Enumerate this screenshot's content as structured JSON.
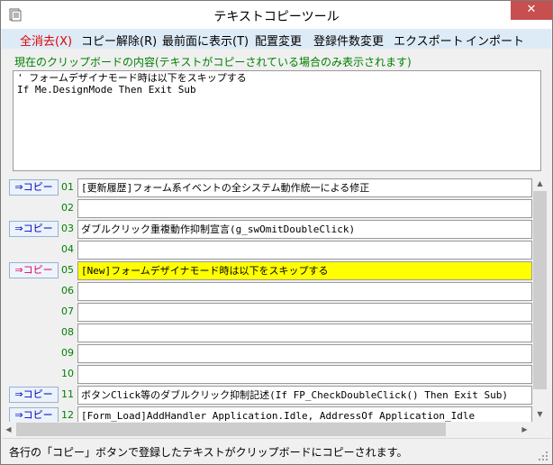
{
  "window": {
    "title": "テキストコピーツール",
    "close_label": "✕"
  },
  "menu": [
    "全消去(X)",
    "コピー解除(R)",
    "最前面に表示(T)",
    "配置変更",
    "登録件数変更",
    "エクスポート",
    "インポート"
  ],
  "clipboard": {
    "label": "現在のクリップボードの内容(テキストがコピーされている場合のみ表示されます)",
    "content": "' フォームデザイナモード時は以下をスキップする\nIf Me.DesignMode Then Exit Sub"
  },
  "copy_label": "⇒コピー",
  "rows": [
    {
      "num": "01",
      "text": "[更新履歴]フォーム系イベントの全システム動作統一による修正",
      "has_copy": true,
      "active": false
    },
    {
      "num": "02",
      "text": "",
      "has_copy": false,
      "active": false
    },
    {
      "num": "03",
      "text": "ダブルクリック重複動作抑制宣言(g_swOmitDoubleClick)",
      "has_copy": true,
      "active": false
    },
    {
      "num": "04",
      "text": "",
      "has_copy": false,
      "active": false
    },
    {
      "num": "05",
      "text": "[New]フォームデザイナモード時は以下をスキップする",
      "has_copy": true,
      "active": true
    },
    {
      "num": "06",
      "text": "",
      "has_copy": false,
      "active": false
    },
    {
      "num": "07",
      "text": "",
      "has_copy": false,
      "active": false
    },
    {
      "num": "08",
      "text": "",
      "has_copy": false,
      "active": false
    },
    {
      "num": "09",
      "text": "",
      "has_copy": false,
      "active": false
    },
    {
      "num": "10",
      "text": "",
      "has_copy": false,
      "active": false
    },
    {
      "num": "11",
      "text": "ボタンClick等のダブルクリック抑制記述(If FP_CheckDoubleClick() Then Exit Sub)",
      "has_copy": true,
      "active": false
    },
    {
      "num": "12",
      "text": "[Form_Load]AddHandler Application.Idle, AddressOf Application_Idle",
      "has_copy": true,
      "active": false
    }
  ],
  "status": {
    "text": "各行の「コピー」ボタンで登録したテキストがクリップボードにコピーされます。"
  },
  "colors": {
    "menubar": "#ddebf7",
    "accent_red": "#e00000",
    "row_number_green": "#008000",
    "active_row_yellow": "#ffff00",
    "copy_text_blue": "#0000c0",
    "close_red": "#c74f4f"
  },
  "icons": {
    "app": "window-icon",
    "close": "close-icon",
    "scroll_up": "chevron-up-icon",
    "scroll_down": "chevron-down-icon",
    "scroll_left": "chevron-left-icon",
    "scroll_right": "chevron-right-icon",
    "resize": "resize-grip-icon"
  }
}
